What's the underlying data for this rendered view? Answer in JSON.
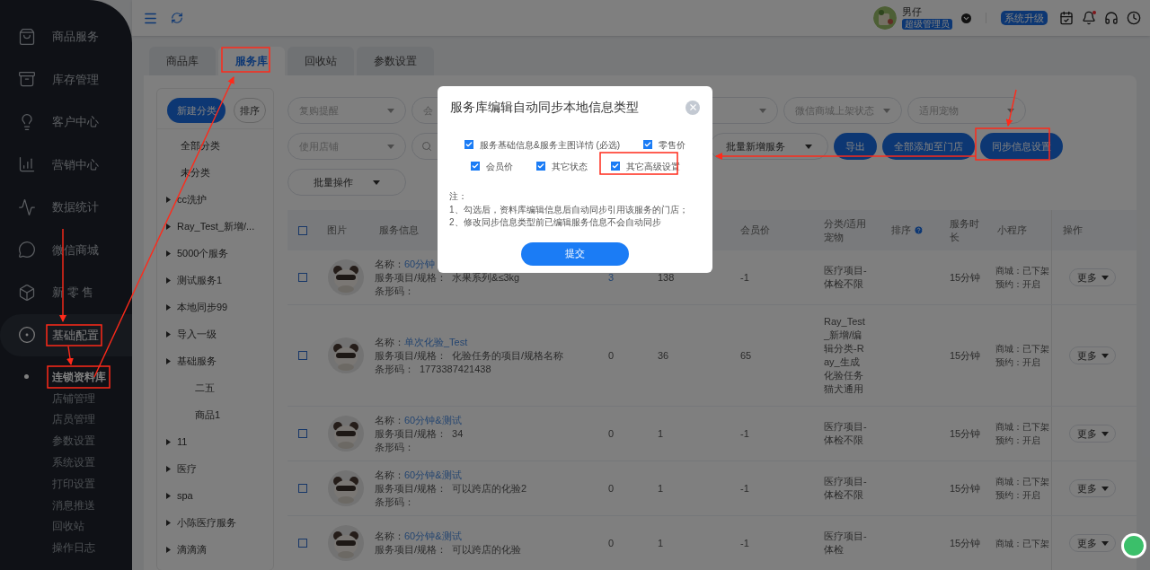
{
  "header": {
    "user_name": "男仔",
    "user_role": "超级管理员",
    "upgrade_button": "系统升级",
    "has_notification": true
  },
  "sidebar": {
    "items": [
      {
        "label": "商品服务",
        "selected": false
      },
      {
        "label": "库存管理",
        "selected": false
      },
      {
        "label": "客户中心",
        "selected": false
      },
      {
        "label": "营销中心",
        "selected": false
      },
      {
        "label": "数据统计",
        "selected": false
      },
      {
        "label": "微信商城",
        "selected": false
      },
      {
        "label": "新 零 售",
        "selected": false
      },
      {
        "label": "基础配置",
        "selected": true,
        "children": [
          {
            "label": "连锁资料库",
            "selected": true
          },
          {
            "label": "店铺管理",
            "selected": false
          },
          {
            "label": "店员管理",
            "selected": false
          },
          {
            "label": "参数设置",
            "selected": false
          },
          {
            "label": "系统设置",
            "selected": false
          },
          {
            "label": "打印设置",
            "selected": false
          },
          {
            "label": "消息推送",
            "selected": false
          },
          {
            "label": "回收站",
            "selected": false
          },
          {
            "label": "操作日志",
            "selected": false
          }
        ]
      }
    ]
  },
  "tabs": [
    {
      "label": "商品库",
      "selected": false
    },
    {
      "label": "服务库",
      "selected": true
    },
    {
      "label": "回收站",
      "selected": false
    },
    {
      "label": "参数设置",
      "selected": false
    }
  ],
  "categories": {
    "new_button": "新建分类",
    "sort_button": "排序",
    "items": [
      {
        "label": "全部分类",
        "kind": "leaf"
      },
      {
        "label": "未分类",
        "kind": "leaf"
      },
      {
        "label": "cc洗护",
        "kind": "folder"
      },
      {
        "label": "Ray_Test_新增/...",
        "kind": "folder"
      },
      {
        "label": "5000个服务",
        "kind": "folder"
      },
      {
        "label": "测试服务1",
        "kind": "folder"
      },
      {
        "label": "本地同步99",
        "kind": "folder"
      },
      {
        "label": "导入一级",
        "kind": "folder"
      },
      {
        "label": "基础服务",
        "kind": "folder",
        "children": [
          {
            "label": "二五",
            "kind": "leaf"
          },
          {
            "label": "商品1",
            "kind": "leaf"
          }
        ]
      },
      {
        "label": "11",
        "kind": "folder"
      },
      {
        "label": "医疗",
        "kind": "folder"
      },
      {
        "label": "spa",
        "kind": "folder"
      },
      {
        "label": "小陈医疗服务",
        "kind": "folder"
      },
      {
        "label": "滴滴滴",
        "kind": "folder"
      }
    ]
  },
  "filters": {
    "rows": [
      {
        "items": [
          {
            "kind": "select",
            "placeholder": "复购提醒"
          },
          {
            "kind": "select",
            "placeholder": "会"
          },
          {
            "kind": "covered"
          },
          {
            "kind": "select"
          },
          {
            "kind": "select",
            "placeholder": "微信商城上架状态"
          },
          {
            "kind": "select",
            "placeholder": "适用宠物"
          }
        ]
      },
      {
        "items": [
          {
            "kind": "select",
            "placeholder": "使用店铺"
          },
          {
            "kind": "search"
          },
          {
            "kind": "dropdown",
            "label": "批量新增服务"
          },
          {
            "kind": "button",
            "label": "导出"
          },
          {
            "kind": "button",
            "label": "全部添加至门店"
          },
          {
            "kind": "button",
            "label": "同步信息设置"
          }
        ]
      },
      {
        "items": [
          {
            "kind": "dropdown",
            "label": "批量操作"
          }
        ]
      }
    ]
  },
  "table": {
    "select_all": {
      "checked": false
    },
    "columns": [
      {
        "kind": "checkbox"
      },
      {
        "kind": "text",
        "label": "图片"
      },
      {
        "kind": "text",
        "label": "服务信息"
      },
      {
        "kind": "covered"
      },
      {
        "kind": "covered"
      },
      {
        "kind": "text",
        "label": "会员价"
      },
      {
        "kind": "text",
        "label": "分类/适用宠物"
      },
      {
        "kind": "text",
        "label": "排序",
        "help": true
      },
      {
        "kind": "text",
        "label": "服务时长"
      },
      {
        "kind": "text",
        "label": "小程序"
      },
      {
        "kind": "text",
        "label": "操作"
      }
    ],
    "rows": [
      {
        "checked": false,
        "name_label": "名称：",
        "name": "60分钟",
        "spec_label": "服务项目/规格：",
        "spec": "水果系列&≤3kg",
        "barcode_label": "条形码：",
        "column_4": {
          "text": "3",
          "link": true
        },
        "column_5": "138",
        "member_price": "-1",
        "category": "医疗项目-体检不限",
        "duration": "15分钟",
        "mall": "商城：已下架",
        "booking": "预约：开启",
        "action": "更多"
      },
      {
        "checked": false,
        "name_label": "名称：",
        "name": "单次化验_Test",
        "spec_label": "服务项目/规格：",
        "spec": "化验任务的项目/规格名称",
        "barcode_label": "条形码：",
        "barcode": "1773387421438",
        "column_4": {
          "text": "0",
          "link": false
        },
        "column_5": "36",
        "member_price": "65",
        "category": "Ray_Test_新增/编辑分类-Ray_生成化验任务猫犬通用",
        "duration": "15分钟",
        "mall": "商城：已下架",
        "booking": "预约：开启",
        "action": "更多"
      },
      {
        "checked": false,
        "name_label": "名称：",
        "name": "60分钟&测试",
        "spec_label": "服务项目/规格：",
        "spec": "34",
        "barcode_label": "条形码：",
        "column_4": {
          "text": "0",
          "link": false
        },
        "column_5": "1",
        "member_price": "-1",
        "category": "医疗项目-体检不限",
        "duration": "15分钟",
        "mall": "商城：已下架",
        "booking": "预约：开启",
        "action": "更多"
      },
      {
        "checked": false,
        "name_label": "名称：",
        "name": "60分钟&测试",
        "spec_label": "服务项目/规格：",
        "spec": "可以跨店的化验2",
        "barcode_label": "条形码：",
        "column_4": {
          "text": "0",
          "link": false
        },
        "column_5": "1",
        "member_price": "-1",
        "category": "医疗项目-体检不限",
        "duration": "15分钟",
        "mall": "商城：已下架",
        "booking": "预约：开启",
        "action": "更多"
      },
      {
        "checked": false,
        "name_label": "名称：",
        "name": "60分钟&测试",
        "spec_label": "服务项目/规格：",
        "spec": "可以跨店的化验",
        "column_4": {
          "text": "0",
          "link": false
        },
        "column_5": "1",
        "member_price": "-1",
        "category": "医疗项目-体检",
        "duration": "15分钟",
        "mall": "商城：已下架",
        "action": "更多"
      }
    ]
  },
  "modal": {
    "title": "服务库编辑自动同步本地信息类型",
    "option_rows": [
      {
        "options": [
          {
            "label": "服务基础信息&服务主图详情 (必选)",
            "checked": true
          },
          {
            "label": "零售价",
            "checked": true
          }
        ]
      },
      {
        "options": [
          {
            "label": "会员价",
            "checked": true
          },
          {
            "label": "其它状态",
            "checked": true
          },
          {
            "label": "其它高级设置",
            "checked": true
          }
        ]
      }
    ],
    "note_title": "注：",
    "notes": [
      "1、勾选后，资料库编辑信息后自动同步引用该服务的门店；",
      "2、修改同步信息类型前已编辑服务信息不会自动同步"
    ],
    "submit": "提交"
  }
}
